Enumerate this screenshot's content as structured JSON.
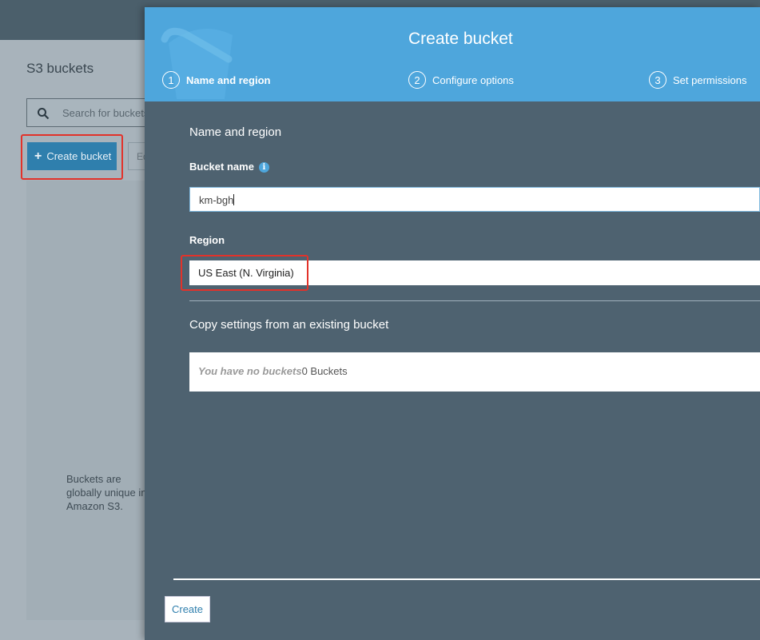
{
  "background": {
    "page_title": "S3 buckets",
    "search_placeholder": "Search for buckets",
    "create_bucket_label": "Create bucket",
    "edit_button_label": "Ed",
    "note_text": "Buckets are globally unique in Amazon S3."
  },
  "modal": {
    "title": "Create bucket",
    "steps": [
      {
        "number": "1",
        "label": "Name and region",
        "active": true
      },
      {
        "number": "2",
        "label": "Configure options",
        "active": false
      },
      {
        "number": "3",
        "label": "Set permissions",
        "active": false
      }
    ],
    "section_heading": "Name and region",
    "bucket_name_label": "Bucket name",
    "bucket_name_value": "km-bgh",
    "region_label": "Region",
    "region_value": "US East (N. Virginia)",
    "copy_heading": "Copy settings from an existing bucket",
    "no_buckets_text": "You have no buckets",
    "bucket_count_text": "0 Buckets",
    "create_button_label": "Create"
  },
  "colors": {
    "header_blue": "#4ea6dc",
    "modal_body": "#4e6270",
    "highlight_red": "#e2322a",
    "primary_button": "#2f7fad"
  }
}
